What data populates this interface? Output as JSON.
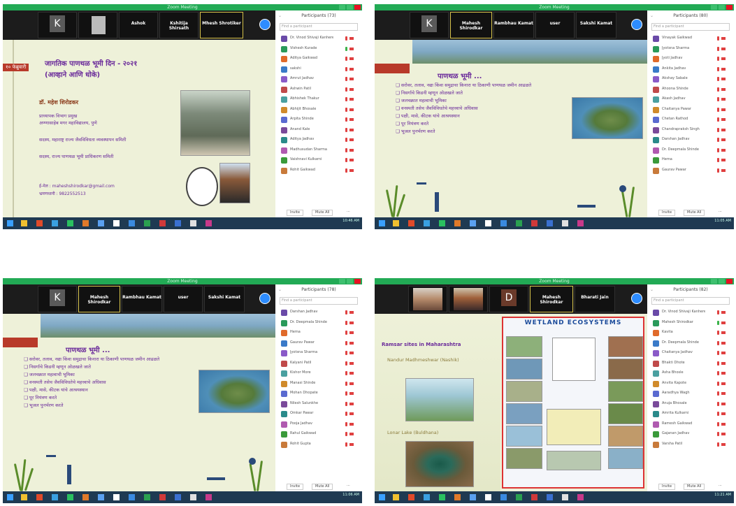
{
  "shots": [
    {
      "id": "tl",
      "window_title": "Zoom Meeting",
      "video_tiles": [
        {
          "label": "K",
          "caption": "",
          "type": "avatar"
        },
        {
          "label": "",
          "caption": "",
          "type": "video"
        },
        {
          "label": "Ashok",
          "type": "name"
        },
        {
          "label": "Kshitija Shirsath",
          "type": "name"
        },
        {
          "label": "Mhesh Shrotiker",
          "type": "name",
          "active": true
        }
      ],
      "participants_title": "Participants (73)",
      "search_placeholder": "Find a participant",
      "participants": [
        "Dr. Vinod Shivaji Kanhere (Host, me)",
        "Vishesh Kurade",
        "Aditya Gaikwad",
        "sakshi",
        "Amrut Jadhav",
        "Ashwin Patil",
        "Abhishek Thakur",
        "Abhijit Bhosale",
        "Arpita Shinde",
        "Anand Kale",
        "Aditya Jadhav",
        "Madhusudan Sharma",
        "Vaishnavi Kulkarni",
        "Rohit Gaikwad"
      ],
      "footer_left": "Invite",
      "footer_right": "Mute All",
      "slide": {
        "tag": "१० फेब्रुवारी",
        "title_l1": "जागतिक पाणथळ भूमी दिन - २०२१",
        "title_l2": "(आव्हाने आणि धोके)",
        "speaker": "डॉ. महेश शिरोडकर",
        "role_l1": "प्राध्यापक विभाग प्रमुख",
        "role_l2": "अण्णासाहेब मगर महाविद्यालय, पुणे",
        "role_l3": "सदस्य, महाराष्ट्र राज्य जैवविविधता व्यवस्थापन समिती",
        "role_l4": "सदस्य, राज्य पाणथळ भूमी प्राधिकरण समिती",
        "email": "ई-मेल : maheshshirodkar@gmail.com",
        "phone": "भ्रमणध्वनी : 9822552513"
      },
      "tray_time": "10:46 AM"
    },
    {
      "id": "tr",
      "window_title": "Zoom Meeting",
      "video_tiles": [
        {
          "label": "K",
          "type": "avatar"
        },
        {
          "label": "Mahesh Shirodkar",
          "type": "name",
          "active": true
        },
        {
          "label": "Rambhau Kamat",
          "type": "name"
        },
        {
          "label": "user",
          "type": "name"
        },
        {
          "label": "Sakshi Kamat",
          "type": "name"
        }
      ],
      "participants_title": "Participants (80)",
      "search_placeholder": "Find a participant",
      "participants": [
        "Vinayak Gaikwad",
        "Jyotsna Sharma",
        "Jyoti Jadhav",
        "Ankita Jadhav",
        "Akshay Sabale",
        "Ahoona Shinde",
        "Akash Jadhav",
        "Chaitanya Pawar",
        "Chetan Rathod",
        "Chandrapraksh Singh",
        "Darshan Jadhav",
        "Dr. Deepmala Shinde",
        "Hema",
        "Gaurav Pawar"
      ],
      "footer_left": "Invite",
      "footer_right": "Mute All",
      "slide": {
        "heading": "पाणथळ भूमी ...",
        "bullets": [
          "सरोवर, तलाव, नद्या किंवा समुद्राचा किनारा या ठिकाणी पाणथळ जमीन आढळते",
          "निसर्गाचे किडनी म्हणून ओळखले जाते",
          "जलचक्रात महत्वाची भूमिका",
          "वनस्पती तसेच जैवविविधतेचे महत्त्वाचे अधिवास",
          "पक्षी, मासे, कीटक यांचे आश्रयस्थान",
          "पूर नियंत्रण करते",
          "भूजल पुनर्भरण करते"
        ]
      },
      "tray_time": "11:05 AM"
    },
    {
      "id": "bl",
      "window_title": "Zoom Meeting",
      "video_tiles": [
        {
          "label": "K",
          "type": "avatar"
        },
        {
          "label": "Mahesh Shirodkar",
          "type": "name",
          "active": true
        },
        {
          "label": "Rambhau Kamat",
          "type": "name"
        },
        {
          "label": "user",
          "type": "name"
        },
        {
          "label": "Sakshi Kamat",
          "type": "name"
        }
      ],
      "participants_title": "Participants (78)",
      "search_placeholder": "Find a participant",
      "participants": [
        "Darshan Jadhav",
        "Dr. Deepmala Shinde",
        "Hema",
        "Gaurav Pawar",
        "Jyotsna Sharma",
        "Kalyani Patil",
        "Kishor More",
        "Manasi Shinde",
        "Mohan Dhopate",
        "Nilesh Salunkhe",
        "Omkar Pawar",
        "Pooja Jadhav",
        "Rahul Gaikwad",
        "Rohit Gupta"
      ],
      "footer_left": "Invite",
      "footer_right": "Mute All",
      "slide": {
        "heading": "पाणथळ भूमी ...",
        "bullets": [
          "सरोवर, तलाव, नद्या किंवा समुद्राचा किनारा या ठिकाणी पाणथळ जमीन आढळते",
          "निसर्गाचे किडनी म्हणून ओळखले जाते",
          "जलचक्रात महत्वाची भूमिका",
          "वनस्पती तसेच जैवविविधतेचे महत्त्वाचे अधिवास",
          "पक्षी, मासे, कीटक यांचे आश्रयस्थान",
          "पूर नियंत्रण करते",
          "भूजल पुनर्भरण करते"
        ]
      },
      "tray_time": "11:06 AM"
    },
    {
      "id": "br",
      "window_title": "Zoom Meeting",
      "video_tiles": [
        {
          "label": "",
          "type": "video"
        },
        {
          "label": "",
          "type": "video"
        },
        {
          "label": "D",
          "type": "avatar"
        },
        {
          "label": "Mahesh Shirodkar",
          "type": "name",
          "active": true
        },
        {
          "label": "Bharati Jain",
          "type": "name"
        }
      ],
      "participants_title": "Participants (82)",
      "search_placeholder": "Find a participant",
      "participants": [
        "Dr. Vinod Shivaji Kanhere (Host, me)",
        "Mahesh Shirodkar",
        "Kavita",
        "Dr. Deepmala Shinde",
        "Chaitanya Jadhav",
        "Bhakti Dhote",
        "Asha Bhosle",
        "Anvita Kapote",
        "Aaradhya Wagh",
        "Anuja Bhosale",
        "Amrita Kulkarni",
        "Ramesh Gaikwad",
        "Gajanan Jadhav",
        "Varsha Patil"
      ],
      "footer_left": "Invite",
      "footer_right": "Mute All",
      "slide": {
        "left_title": "Ramsar sites in Maharashtra",
        "site1": "Nandur Madhmeshwar (Nashik)",
        "site2": "Lonar Lake (Buldhana)",
        "poster_title": "WETLAND ECOSYSTEMS"
      },
      "tray_time": "11:21 AM"
    }
  ],
  "colors": {
    "zoom_green": "#22aa55",
    "zoom_blue": "#2d8cff",
    "slide_purple": "#6a2a9a",
    "taskbar": "#1f3a52",
    "close_red": "#e81123"
  }
}
